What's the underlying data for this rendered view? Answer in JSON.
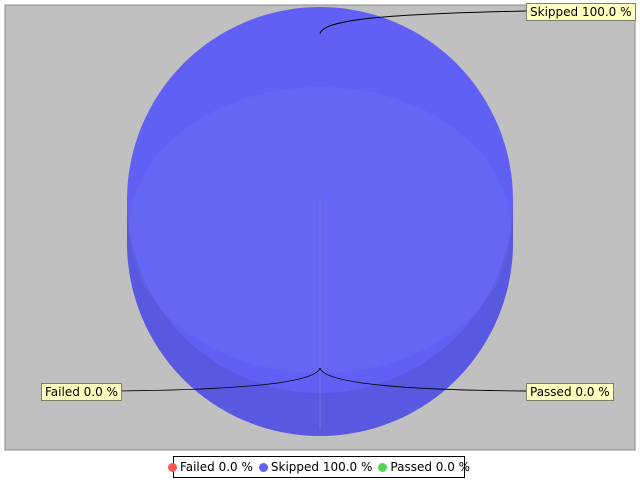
{
  "chart_data": {
    "type": "pie",
    "style": "3d",
    "slices": [
      {
        "label": "Failed",
        "value": 0.0,
        "percent_label": "Failed 0.0 %",
        "color": "#ff5555"
      },
      {
        "label": "Skipped",
        "value": 100.0,
        "percent_label": "Skipped 100.0 %",
        "color": "#6060f4"
      },
      {
        "label": "Passed",
        "value": 0.0,
        "percent_label": "Passed 0.0 %",
        "color": "#55d455"
      }
    ],
    "legend_position": "bottom",
    "plot_background": "#c0c0c0",
    "callout_background": "#ffffc0"
  }
}
